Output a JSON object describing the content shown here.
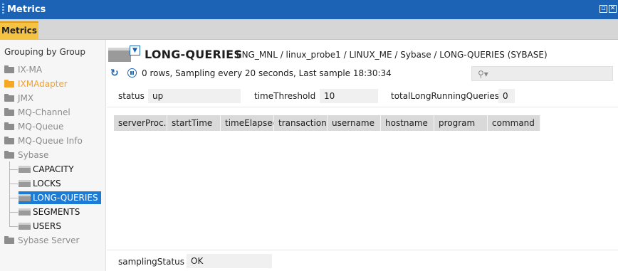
{
  "window": {
    "title": "Metrics",
    "restore_icon": "restore-icon",
    "close_icon": "close-icon"
  },
  "tabs": [
    {
      "label": "Metrics",
      "active": true
    }
  ],
  "sidebar": {
    "heading": "Grouping by Group",
    "groups": [
      {
        "label": "IX-MA"
      },
      {
        "label": "IXMAdapter",
        "highlight": true
      },
      {
        "label": "JMX"
      },
      {
        "label": "MQ-Channel"
      },
      {
        "label": "MQ-Queue"
      },
      {
        "label": "MQ-Queue Info"
      },
      {
        "label": "Sybase",
        "expanded": true,
        "children": [
          {
            "label": "CAPACITY"
          },
          {
            "label": "LOCKS"
          },
          {
            "label": "LONG-QUERIES",
            "selected": true
          },
          {
            "label": "SEGMENTS"
          },
          {
            "label": "USERS"
          }
        ]
      },
      {
        "label": "Sybase Server"
      }
    ]
  },
  "main": {
    "title": "LONG-QUERIES",
    "path": "ENG_MNL / linux_probe1 / LINUX_ME / Sybase / LONG-QUERIES (SYBASE)",
    "status_line": "0 rows, Sampling every 20 seconds, Last sample 18:30:34",
    "search_placeholder": "",
    "fields": {
      "status": {
        "label": "status",
        "value": "up"
      },
      "timeThreshold": {
        "label": "timeThreshold",
        "value": "10"
      },
      "totalLongRunningQueries": {
        "label": "totalLongRunningQueries",
        "value": "0"
      }
    },
    "table": {
      "columns": [
        "serverProc...",
        "startTime",
        "timeElapsed",
        "transaction",
        "username",
        "hostname",
        "program",
        "command"
      ],
      "rows": []
    },
    "footer": {
      "label": "samplingStatus",
      "value": "OK"
    }
  },
  "colors": {
    "titlebar": "#1c63b5",
    "tab_active": "#f5c242",
    "selected": "#1c7cd5",
    "folder_orange": "#f4a825"
  }
}
